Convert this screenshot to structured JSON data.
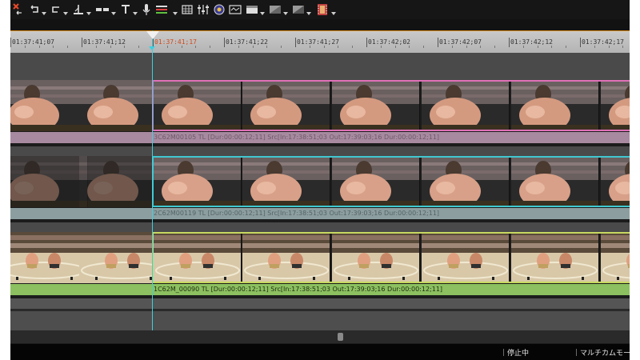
{
  "toolbar": {
    "icons": [
      "close-x-icon",
      "undo-icon",
      "redo-icon",
      "split-icon",
      "trim-icon",
      "title-icon",
      "mic-icon",
      "audio-mix-icon",
      "grid-icon",
      "mixer-sliders-icon",
      "record-circle-icon",
      "monitor-icon",
      "window-icon",
      "picture-icon",
      "export-icon",
      "film-strip-icon"
    ]
  },
  "ruler": {
    "labels": [
      "01:37:41;07",
      "01:37:41;12",
      "01:37:41;17",
      "01:37:41;22",
      "01:37:41;27",
      "01:37:42;02",
      "01:37:42;07",
      "01:37:42;12",
      "01:37:42;17"
    ],
    "current_index": 2
  },
  "tracks": [
    {
      "label": "3C62M00105  TL [Dur:00:00:12;11]  Src[In:17:38:51;03 Out:17:39:03;16 Dur:00:00:12;11]",
      "accent": "#e070b8",
      "label_bg": "#a88aa0",
      "label_color": "#6c5a68"
    },
    {
      "label": "2C62M00119  TL [Dur:00:00:12;11]  Src[In:17:38:51;03 Out:17:39:03;16 Dur:00:00:12;11]",
      "accent": "#40c8d0",
      "label_bg": "#8c9ea0",
      "label_color": "#556466"
    },
    {
      "label": "1C62M_00090  TL [Dur:00:00:12;11]  Src[In:17:38:51;03 Out:17:39:03;16 Dur:00:00:12;11]",
      "accent": "#c8d860",
      "label_bg": "#8cc060",
      "label_color": "#203010"
    }
  ],
  "status": {
    "state": "｜停止中",
    "mode": "｜マルチカムモード"
  }
}
